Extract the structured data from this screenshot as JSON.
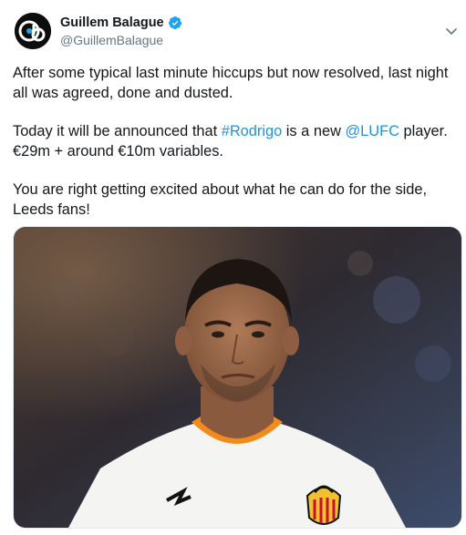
{
  "author": {
    "display_name": "Guillem Balague",
    "handle": "@GuillemBalague",
    "verified": true,
    "avatar_icon": "gb-logo-icon"
  },
  "menu": {
    "icon": "chevron-down-icon"
  },
  "tweet": {
    "para1": "After some typical last minute hiccups but now resolved, last night all was agreed, done and dusted.",
    "para2_pre": "Today it will be announced that ",
    "hashtag": "#Rodrigo",
    "para2_mid": " is a new ",
    "mention": "@LUFC",
    "para2_post": " player. €29m + around €10m variables.",
    "para3": "You are right getting excited about what he can do for the side, Leeds fans!"
  },
  "media": {
    "kind": "photo",
    "subject": "footballer-portrait"
  },
  "colors": {
    "link": "#1b95e0",
    "verified": "#1da1f2",
    "handle": "#657786",
    "text": "#14171a"
  }
}
